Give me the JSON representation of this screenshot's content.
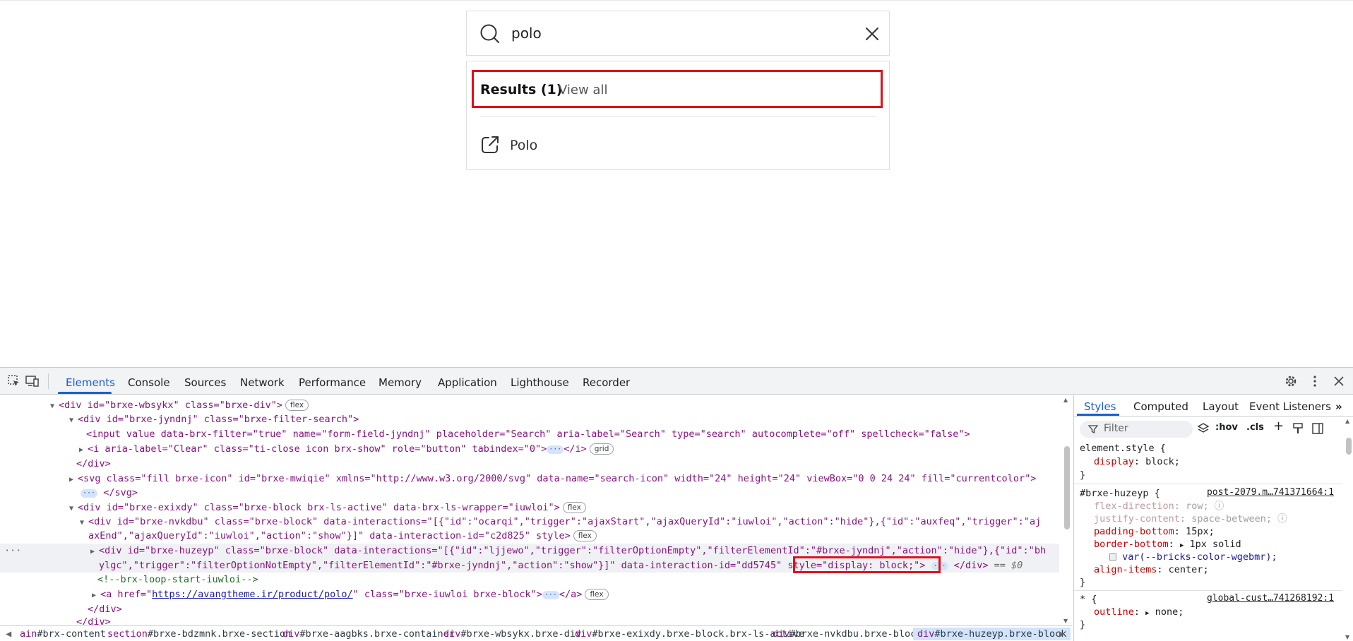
{
  "search": {
    "value": "polo"
  },
  "results": {
    "heading": "Results (1)",
    "view_all": "View all",
    "items": [
      {
        "label": "Polo"
      }
    ]
  },
  "colors": {
    "highlight_box": "#e0101a",
    "devtools_accent": "#1a5fd0"
  },
  "devtools": {
    "tabs": [
      "Elements",
      "Console",
      "Sources",
      "Network",
      "Performance",
      "Memory",
      "Application",
      "Lighthouse",
      "Recorder"
    ],
    "active_tab": "Elements",
    "dom": {
      "l1_open": "<div id=\"brxe-wbsykx\" class=\"brxe-div\">",
      "l1_badge": "flex",
      "l2": "<div id=\"brxe-jyndnj\" class=\"brxe-filter-search\">",
      "l3": "<input value data-brx-filter=\"true\" name=\"form-field-jyndnj\" placeholder=\"Search\" aria-label=\"Search\" type=\"search\" autocomplete=\"off\" spellcheck=\"false\">",
      "l4": "<i aria-label=\"Clear\" class=\"ti-close icon brx-show\" role=\"button\" tabindex=\"0\">",
      "l4_end": "</i>",
      "l4_badge": "grid",
      "l5": "</div>",
      "l6": "<svg class=\"fill brxe-icon\" id=\"brxe-mwiqie\" xmlns=\"http://www.w3.org/2000/svg\" data-name=\"search-icon\" width=\"24\" height=\"24\" viewBox=\"0 0 24 24\" fill=\"currentcolor\">",
      "l7": "</svg>",
      "l8": "<div id=\"brxe-exixdy\" class=\"brxe-block brx-ls-active\" data-brx-ls-wrapper=\"iuwloi\">",
      "l8_badge": "flex",
      "l9": "<div id=\"brxe-nvkdbu\" class=\"brxe-block\" data-interactions=\"[{\"id\":\"ocarqi\",\"trigger\":\"ajaxStart\",\"ajaxQueryId\":\"iuwloi\",\"action\":\"hide\"},{\"id\":\"auxfeq\",\"trigger\":\"aj",
      "l10": "axEnd\",\"ajaxQueryId\":\"iuwloi\",\"action\":\"show\"}]\" data-interaction-id=\"c2d825\" style>",
      "l10_badge": "flex",
      "l11": "<div id=\"brxe-huzeyp\" class=\"brxe-block\" data-interactions=\"[{\"id\":\"ljjewo\",\"trigger\":\"filterOptionEmpty\",\"filterElementId\":\"#brxe-jyndnj\",\"action\":\"hide\"},{\"id\":\"bh",
      "l12a": "ylgc\",\"trigger\":\"filterOptionNotEmpty\",\"filterElementId\":\"#brxe-jyndnj\",\"action\":\"show\"}]\" data-interaction-id=\"dd5745\" ",
      "l12_style": "style=\"display: block;\">",
      "l12_end": "</div>",
      "l12_eq": "== $0",
      "l13": "<!--brx-loop-start-iuwloi-->",
      "l14a": "<a href=\"",
      "l14_href": "https://avangtheme.ir/product/polo/",
      "l14b": "\" class=\"brxe-iuwloi brxe-block\">",
      "l14_end": "</a>",
      "l14_badge": "flex",
      "l15": "</div>",
      "l16": "</div>"
    },
    "breadcrumbs": [
      {
        "tag": "ain",
        "cls": "#brx-content"
      },
      {
        "tag": "section",
        "cls": "#brxe-bdzmnk.brxe-section"
      },
      {
        "tag": "div",
        "cls": "#brxe-aagbks.brxe-container"
      },
      {
        "tag": "div",
        "cls": "#brxe-wbsykx.brxe-div"
      },
      {
        "tag": "div",
        "cls": "#brxe-exixdy.brxe-block.brx-ls-active"
      },
      {
        "tag": "div",
        "cls": "#brxe-nvkdbu.brxe-block"
      },
      {
        "tag": "div",
        "cls": "#brxe-huzeyp.brxe-block"
      }
    ],
    "styles": {
      "tabs": [
        "Styles",
        "Computed",
        "Layout",
        "Event Listeners"
      ],
      "filter_placeholder": "Filter",
      "hov": ":hov",
      "cls": ".cls",
      "rule1_selector": "element.style {",
      "rule1_prop": "display",
      "rule1_val": "block;",
      "rule2_selector": "#brxe-huzeyp {",
      "rule2_source": "post-2079.m…741371664:1",
      "rule2_p1": "flex-direction",
      "rule2_v1": "row;",
      "rule2_p2": "justify-content",
      "rule2_v2": "space-between;",
      "rule2_p3": "padding-bottom",
      "rule2_v3": "15px;",
      "rule2_p4": "border-bottom",
      "rule2_v4": "1px solid",
      "rule2_v4b": "var(--bricks-color-wgebmr);",
      "rule2_p5": "align-items",
      "rule2_v5": "center;",
      "rule3_selector": "* {",
      "rule3_source": "global-cust…741268192:1",
      "rule3_p1": "outline",
      "rule3_v1": "none;",
      "close_brace": "}"
    }
  }
}
